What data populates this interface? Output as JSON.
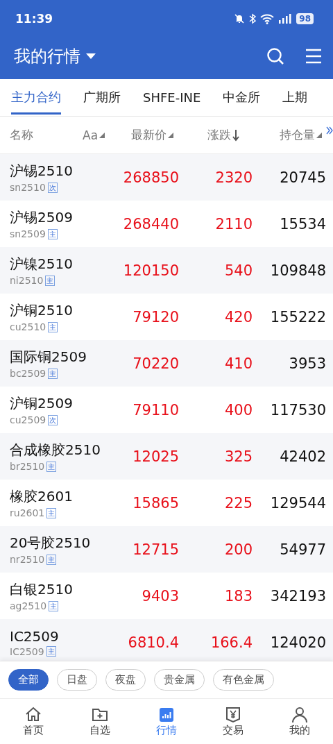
{
  "status_bar": {
    "time": "11:39",
    "battery": "98"
  },
  "header": {
    "title": "我的行情"
  },
  "tabs": [
    {
      "label": "主力合约",
      "selected": true
    },
    {
      "label": "广期所",
      "selected": false
    },
    {
      "label": "SHFE-INE",
      "selected": false
    },
    {
      "label": "中金所",
      "selected": false
    },
    {
      "label": "上期",
      "selected": false
    }
  ],
  "table": {
    "columns": [
      {
        "label": "名称",
        "kind": "plain"
      },
      {
        "label": "Aa",
        "kind": "sortable"
      },
      {
        "label": "最新价",
        "kind": "sortable"
      },
      {
        "label": "涨跌",
        "kind": "descending"
      },
      {
        "label": "持仓量",
        "kind": "sortable"
      }
    ],
    "rows": [
      {
        "name": "沪锡2510",
        "code": "sn2510",
        "tag": "次",
        "price": "268850",
        "change": "2320",
        "open_interest": "20745",
        "rising": true
      },
      {
        "name": "沪锡2509",
        "code": "sn2509",
        "tag": "主",
        "price": "268440",
        "change": "2110",
        "open_interest": "15534",
        "rising": true
      },
      {
        "name": "沪镍2510",
        "code": "ni2510",
        "tag": "主",
        "price": "120150",
        "change": "540",
        "open_interest": "109848",
        "rising": true
      },
      {
        "name": "沪铜2510",
        "code": "cu2510",
        "tag": "主",
        "price": "79120",
        "change": "420",
        "open_interest": "155222",
        "rising": true
      },
      {
        "name": "国际铜2509",
        "code": "bc2509",
        "tag": "主",
        "price": "70220",
        "change": "410",
        "open_interest": "3953",
        "rising": true
      },
      {
        "name": "沪铜2509",
        "code": "cu2509",
        "tag": "次",
        "price": "79110",
        "change": "400",
        "open_interest": "117530",
        "rising": true
      },
      {
        "name": "合成橡胶2510",
        "code": "br2510",
        "tag": "主",
        "price": "12025",
        "change": "325",
        "open_interest": "42402",
        "rising": true
      },
      {
        "name": "橡胶2601",
        "code": "ru2601",
        "tag": "主",
        "price": "15865",
        "change": "225",
        "open_interest": "129544",
        "rising": true
      },
      {
        "name": "20号胶2510",
        "code": "nr2510",
        "tag": "主",
        "price": "12715",
        "change": "200",
        "open_interest": "54977",
        "rising": true
      },
      {
        "name": "白银2510",
        "code": "ag2510",
        "tag": "主",
        "price": "9403",
        "change": "183",
        "open_interest": "342193",
        "rising": true
      },
      {
        "name": "IC2509",
        "code": "IC2509",
        "tag": "主",
        "price": "6810.4",
        "change": "166.4",
        "open_interest": "124020",
        "rising": true
      }
    ]
  },
  "filters": [
    {
      "label": "全部",
      "selected": true
    },
    {
      "label": "日盘",
      "selected": false
    },
    {
      "label": "夜盘",
      "selected": false
    },
    {
      "label": "贵金属",
      "selected": false
    },
    {
      "label": "有色金属",
      "selected": false
    }
  ],
  "bottom_nav": [
    {
      "label": "首页",
      "kind": "home",
      "selected": false
    },
    {
      "label": "自选",
      "kind": "watchlist",
      "selected": false
    },
    {
      "label": "行情",
      "kind": "market",
      "selected": true
    },
    {
      "label": "交易",
      "kind": "trade",
      "selected": false
    },
    {
      "label": "我的",
      "kind": "profile",
      "selected": false
    }
  ]
}
